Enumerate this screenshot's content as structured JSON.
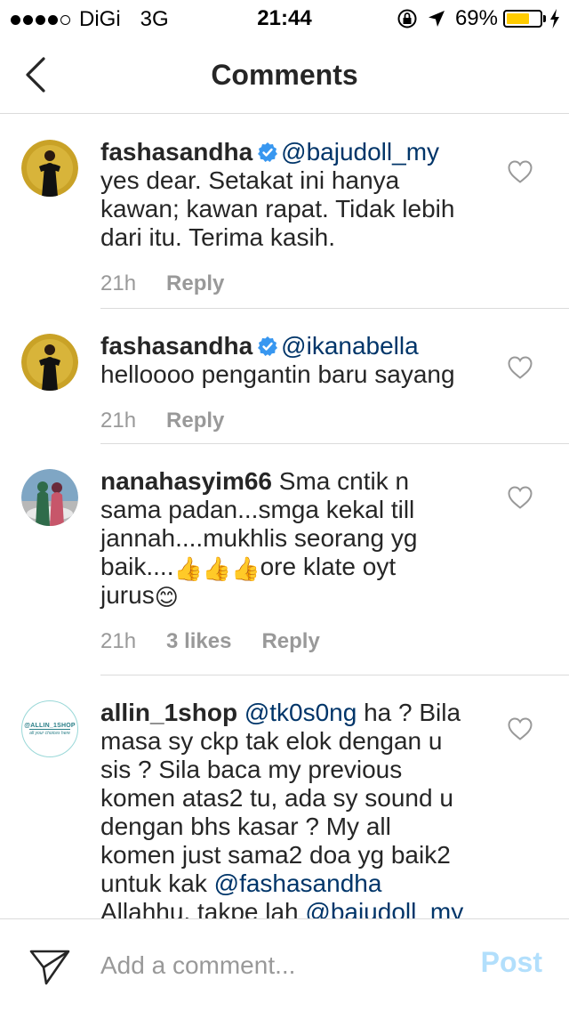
{
  "status_bar": {
    "carrier": "DiGi",
    "network": "3G",
    "time": "21:44",
    "battery": "69%",
    "battery_level": 0.69
  },
  "header": {
    "title": "Comments"
  },
  "comments": [
    {
      "username": "fashasandha",
      "verified": true,
      "mention": "@bajudoll_my",
      "text_lines": [
        "yes dear. Setakat ini hanya",
        "kawan; kawan rapat. Tidak lebih",
        "dari itu. Terima kasih."
      ],
      "time": "21h",
      "reply": "Reply"
    },
    {
      "username": "fashasandha",
      "verified": true,
      "mention": "@ikanabella",
      "text_lines": [
        "helloooo pengantin baru sayang"
      ],
      "time": "21h",
      "reply": "Reply"
    },
    {
      "username": "nanahasyim66",
      "verified": false,
      "first_text": "Sma cntik n",
      "text_lines": [
        "sama padan...smga kekal till",
        "jannah....mukhlis seorang yg",
        "baik...."
      ],
      "line4_rest": "ore klate oyt",
      "line5": "jurus",
      "emoji_thumbs": "👍",
      "emoji_smile": "😊",
      "time": "21h",
      "likes": "3 likes",
      "reply": "Reply"
    },
    {
      "username": "allin_1shop",
      "avatar_text": "@ALLIN_1SHOP",
      "avatar_subtext": "all your choices here",
      "verified": false,
      "mention": "@tk0s0ng",
      "first_text": "ha ? Bila",
      "text_lines": [
        "masa sy ckp tak elok dengan u",
        "sis ? Sila baca my previous",
        "komen atas2 tu, ada sy sound u",
        "dengan bhs kasar ? My all",
        "komen just sama2 doa yg baik2"
      ],
      "line7_prefix": "untuk kak",
      "mention2": "@fashasandha",
      "line8_prefix": "Allahhu, takpe lah",
      "mention3": "@bajudoll_my"
    }
  ],
  "composer": {
    "placeholder": "Add a comment...",
    "post_label": "Post"
  },
  "colors": {
    "mention": "#003569",
    "meta": "#999999",
    "divider": "#dbdbdb",
    "post_disabled": "#b2dffc",
    "verified": "#3897f0",
    "battery": "#ffcc00"
  },
  "icons": [
    "back-chevron-icon",
    "verified-badge-icon",
    "heart-icon",
    "send-icon",
    "lock-rotation-icon",
    "location-arrow-icon",
    "charging-bolt-icon"
  ]
}
